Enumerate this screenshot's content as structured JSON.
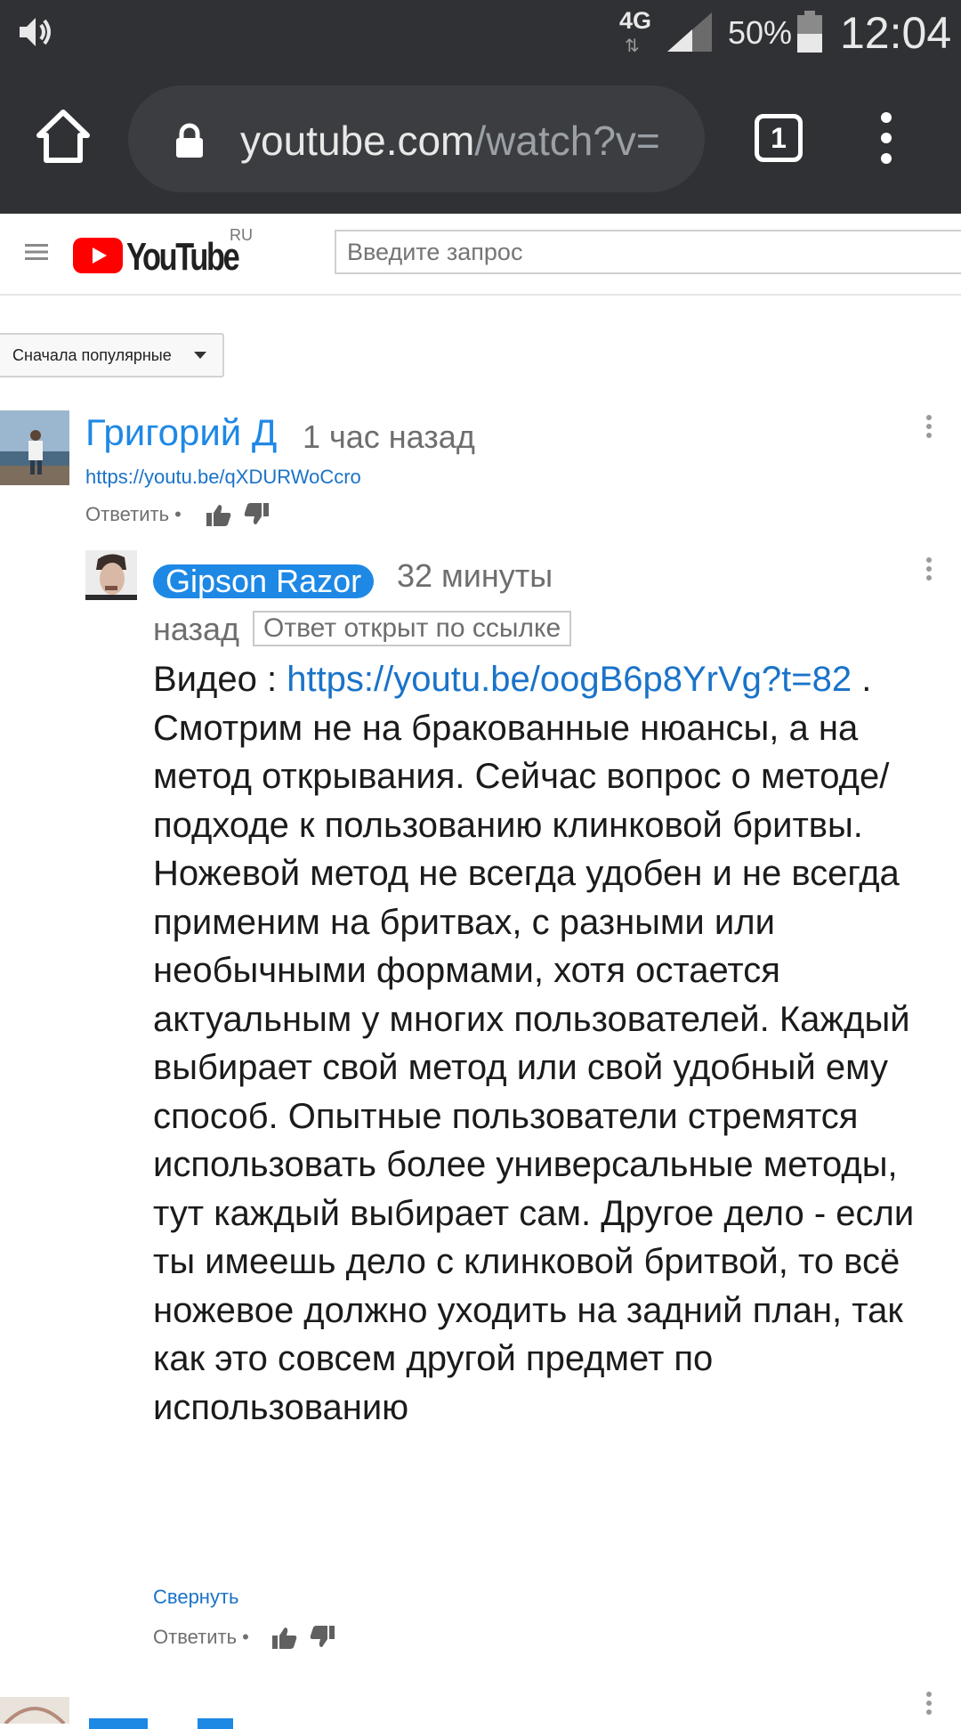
{
  "status_bar": {
    "network": "4G",
    "network_arrows": "⇅",
    "battery": "50%",
    "time": "12:04",
    "icons": [
      "speaker-icon",
      "signal-icon",
      "battery-icon"
    ]
  },
  "browser": {
    "url_host": "youtube.com",
    "url_path": "/watch?v=",
    "tab_count": "1",
    "icons": [
      "home-icon",
      "lock-icon",
      "more-vert-icon"
    ]
  },
  "youtube": {
    "logo_text": "YouTube",
    "region": "RU",
    "search_placeholder": "Введите запрос",
    "sort_label": "Сначала популярные"
  },
  "comments": [
    {
      "author": "Григорий Д",
      "time": "1 час назад",
      "link": "https://youtu.be/qXDURWoCcro",
      "reply_label": "Ответить",
      "separator": "•"
    },
    {
      "author": "Gipson Razor",
      "time_part1": "32 минуты",
      "time_part2": "назад",
      "linked_tag": "Ответ открыт по ссылке",
      "body_prefix": "Видео :  ",
      "body_link": "https://youtu.be/oogB6p8YrVg?t=82",
      "body_text": "  . Смотрим не на бракованные нюансы, а на метод открывания. Сейчас вопрос о  методе/подходе к пользованию клинковой бритвы. Ножевой метод не всегда удобен и не всегда применим на бритвах, с разными или необычными  формами, хотя остается актуальным  у многих пользователей.  Каждый выбирает свой метод или свой удобный ему способ. Опытные пользователи стремятся использовать более универсальные методы,  тут каждый выбирает сам. Другое дело - если ты имеешь дело с клинковой бритвой, то всё ножевое должно уходить на задний план, так как это совсем другой предмет по использованию",
      "collapse_label": "Свернуть",
      "reply_label": "Ответить",
      "separator": "•"
    }
  ],
  "colors": {
    "chrome_bg": "#303134",
    "link_blue": "#1a73c8",
    "author_blue": "#1e88e5",
    "youtube_red": "#ff0000"
  }
}
